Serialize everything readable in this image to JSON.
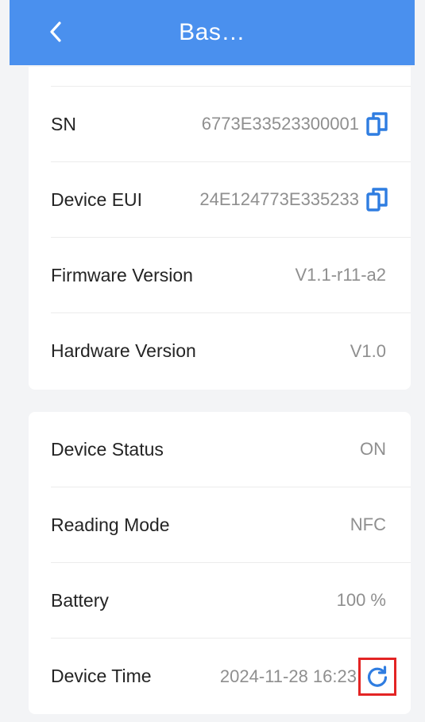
{
  "header": {
    "title": "Bas…",
    "back_icon": "chevron-left-icon",
    "background_color": "#4a90ee"
  },
  "device_info": {
    "rows": [
      {
        "label": "SN",
        "value": "6773E33523300001",
        "icon": "copy-icon"
      },
      {
        "label": "Device EUI",
        "value": "24E124773E335233",
        "icon": "copy-icon"
      },
      {
        "label": "Firmware Version",
        "value": "V1.1-r11-a2"
      },
      {
        "label": "Hardware Version",
        "value": "V1.0"
      }
    ]
  },
  "device_status": {
    "rows": [
      {
        "label": "Device Status",
        "value": "ON"
      },
      {
        "label": "Reading Mode",
        "value": "NFC"
      },
      {
        "label": "Battery",
        "value": "100 %"
      },
      {
        "label": "Device Time",
        "value": "2024-11-28 16:23",
        "icon": "refresh-icon",
        "highlight_color": "#e32424"
      }
    ]
  },
  "accent_color": "#2f7de1"
}
